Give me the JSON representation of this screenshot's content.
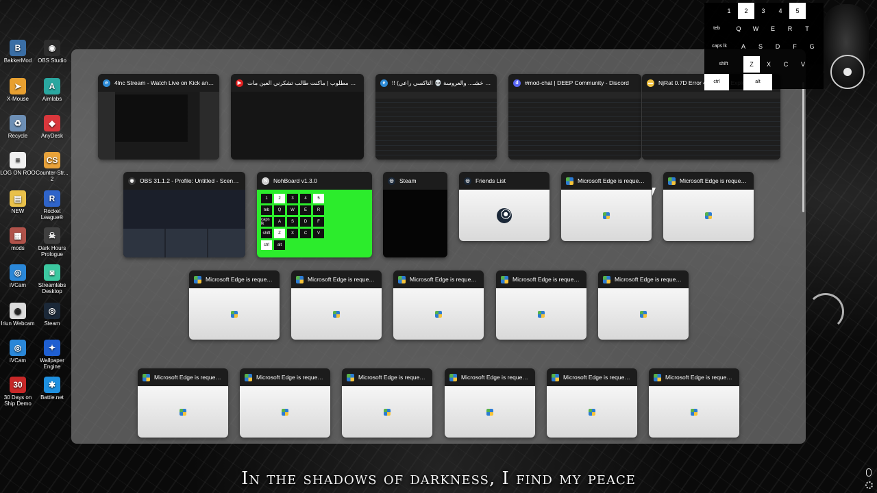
{
  "desktop": {
    "icons": [
      {
        "label": "BakkerMod",
        "glyph": "B",
        "color": "#3a6ea5"
      },
      {
        "label": "OBS Studio",
        "glyph": "◉",
        "color": "#2d2d2d"
      },
      {
        "label": "X-Mouse",
        "glyph": "➤",
        "color": "#e8a030"
      },
      {
        "label": "Aimlabs",
        "glyph": "A",
        "color": "#2aa7a0"
      },
      {
        "label": "Recycle",
        "glyph": "♻",
        "color": "#6d8fb5"
      },
      {
        "label": "AnyDesk",
        "glyph": "◆",
        "color": "#d9373c"
      },
      {
        "label": "LOG ON ROO",
        "glyph": "≡",
        "color": "#f0f0f0"
      },
      {
        "label": "Counter-Str... 2",
        "glyph": "CS",
        "color": "#e8a23a"
      },
      {
        "label": "NEW",
        "glyph": "▤",
        "color": "#e8c04a"
      },
      {
        "label": "Rocket League®",
        "glyph": "R",
        "color": "#2f64c9"
      },
      {
        "label": "mods",
        "glyph": "▦",
        "color": "#b0524a"
      },
      {
        "label": "Dark Hours Prologue",
        "glyph": "☠",
        "color": "#404040"
      },
      {
        "label": "iVCam",
        "glyph": "◎",
        "color": "#2a87d8"
      },
      {
        "label": "Streamlabs Desktop",
        "glyph": "◙",
        "color": "#3cc8a0"
      },
      {
        "label": "Iriun Webcam",
        "glyph": "◉",
        "color": "#dcdcdc"
      },
      {
        "label": "Steam",
        "glyph": "◎",
        "color": "#1b2838"
      },
      {
        "label": "iVCam",
        "glyph": "◎",
        "color": "#2a87d8"
      },
      {
        "label": "Wallpaper Engine",
        "glyph": "✦",
        "color": "#1f5fd1"
      },
      {
        "label": "30 Days on Ship Demo",
        "glyph": "30",
        "color": "#c82828"
      },
      {
        "label": "Battle.net",
        "glyph": "✱",
        "color": "#1e90e0"
      }
    ]
  },
  "task_view": {
    "rows": [
      [
        {
          "title": "4lnc Stream - Watch Live on Kick and 1...",
          "icon": "edge-icon",
          "icon_color": "#2e8bd6",
          "thumb": "stream"
        },
        {
          "title": "خليجي مطلوب | ماكنت طالب تشكرني العين مات...",
          "icon": "youtube-icon",
          "icon_color": "#e02020",
          "thumb": "dark"
        },
        {
          "title": "!! (قصص خشـ... والعروسة 💀 التاكسي راعي",
          "icon": "edge-icon",
          "icon_color": "#2e8bd6",
          "thumb": "darkui"
        },
        {
          "title": "#mod-chat | DEEP Community - Discord",
          "icon": "discord-icon",
          "icon_color": "#5865f2",
          "thumb": "darkui"
        },
        {
          "title": "NjRat 0.7D Error 40... - File Explorer",
          "icon": "folder-icon",
          "icon_color": "#f0c040",
          "thumb": "darkui"
        }
      ],
      [
        {
          "title": "OBS 31.1.2 - Profile: Untitled - Scenes:...",
          "icon": "obs-icon",
          "icon_color": "#3a3a3a",
          "thumb": "obs"
        },
        {
          "title": "NohBoard v1.3.0",
          "icon": "nohboard-icon",
          "icon_color": "#d0d0d0",
          "thumb": "nohboard"
        },
        {
          "title": "Steam",
          "icon": "steam-icon",
          "icon_color": "#1b2838",
          "thumb": "black"
        },
        {
          "title": "Friends List",
          "icon": "steam-icon",
          "icon_color": "#1b2838",
          "thumb": "steam"
        },
        {
          "title": "Microsoft Edge is requesti...",
          "icon": "shield-icon",
          "icon_color": "#2b7cd3",
          "thumb": "uac"
        },
        {
          "title": "Microsoft Edge is requesti...",
          "icon": "shield-icon",
          "icon_color": "#2b7cd3",
          "thumb": "uac"
        }
      ],
      [
        {
          "title": "Microsoft Edge is requesti...",
          "icon": "shield-icon",
          "icon_color": "#2b7cd3",
          "thumb": "uac"
        },
        {
          "title": "Microsoft Edge is requesti...",
          "icon": "shield-icon",
          "icon_color": "#2b7cd3",
          "thumb": "uac"
        },
        {
          "title": "Microsoft Edge is requesti...",
          "icon": "shield-icon",
          "icon_color": "#2b7cd3",
          "thumb": "uac"
        },
        {
          "title": "Microsoft Edge is requesti...",
          "icon": "shield-icon",
          "icon_color": "#2b7cd3",
          "thumb": "uac"
        },
        {
          "title": "Microsoft Edge is requesti...",
          "icon": "shield-icon",
          "icon_color": "#2b7cd3",
          "thumb": "uac"
        }
      ],
      [
        {
          "title": "Microsoft Edge is requesti...",
          "icon": "shield-icon",
          "icon_color": "#2b7cd3",
          "thumb": "uac"
        },
        {
          "title": "Microsoft Edge is requesti...",
          "icon": "shield-icon",
          "icon_color": "#2b7cd3",
          "thumb": "uac"
        },
        {
          "title": "Microsoft Edge is requesti...",
          "icon": "shield-icon",
          "icon_color": "#2b7cd3",
          "thumb": "uac"
        },
        {
          "title": "Microsoft Edge is requesti...",
          "icon": "shield-icon",
          "icon_color": "#2b7cd3",
          "thumb": "uac"
        },
        {
          "title": "Microsoft Edge is requesti...",
          "icon": "shield-icon",
          "icon_color": "#2b7cd3",
          "thumb": "uac"
        },
        {
          "title": "Microsoft Edge is requesti...",
          "icon": "shield-icon",
          "icon_color": "#2b7cd3",
          "thumb": "uac"
        }
      ]
    ]
  },
  "nohboard_overlay": {
    "keys": [
      "1",
      "2",
      "3",
      "4",
      "5",
      "teb",
      "Q",
      "W",
      "E",
      "R",
      "T",
      "caps lk",
      "A",
      "S",
      "D",
      "F",
      "G",
      "shift",
      "Z",
      "X",
      "C",
      "V",
      "ctrl",
      "alt"
    ],
    "pressed": [
      "2",
      "5",
      "Z",
      "ctrl",
      "alt"
    ]
  },
  "nohboard_thumb_keys": [
    "1",
    "2",
    "3",
    "4",
    "5",
    "teb",
    "Q",
    "W",
    "E",
    "R",
    "caps lk",
    "A",
    "S",
    "D",
    "F",
    "shift",
    "Z",
    "X",
    "C",
    "V",
    "ctrl",
    "alt"
  ],
  "wallpaper_caption": "In the shadows of darkness, I find my peace"
}
